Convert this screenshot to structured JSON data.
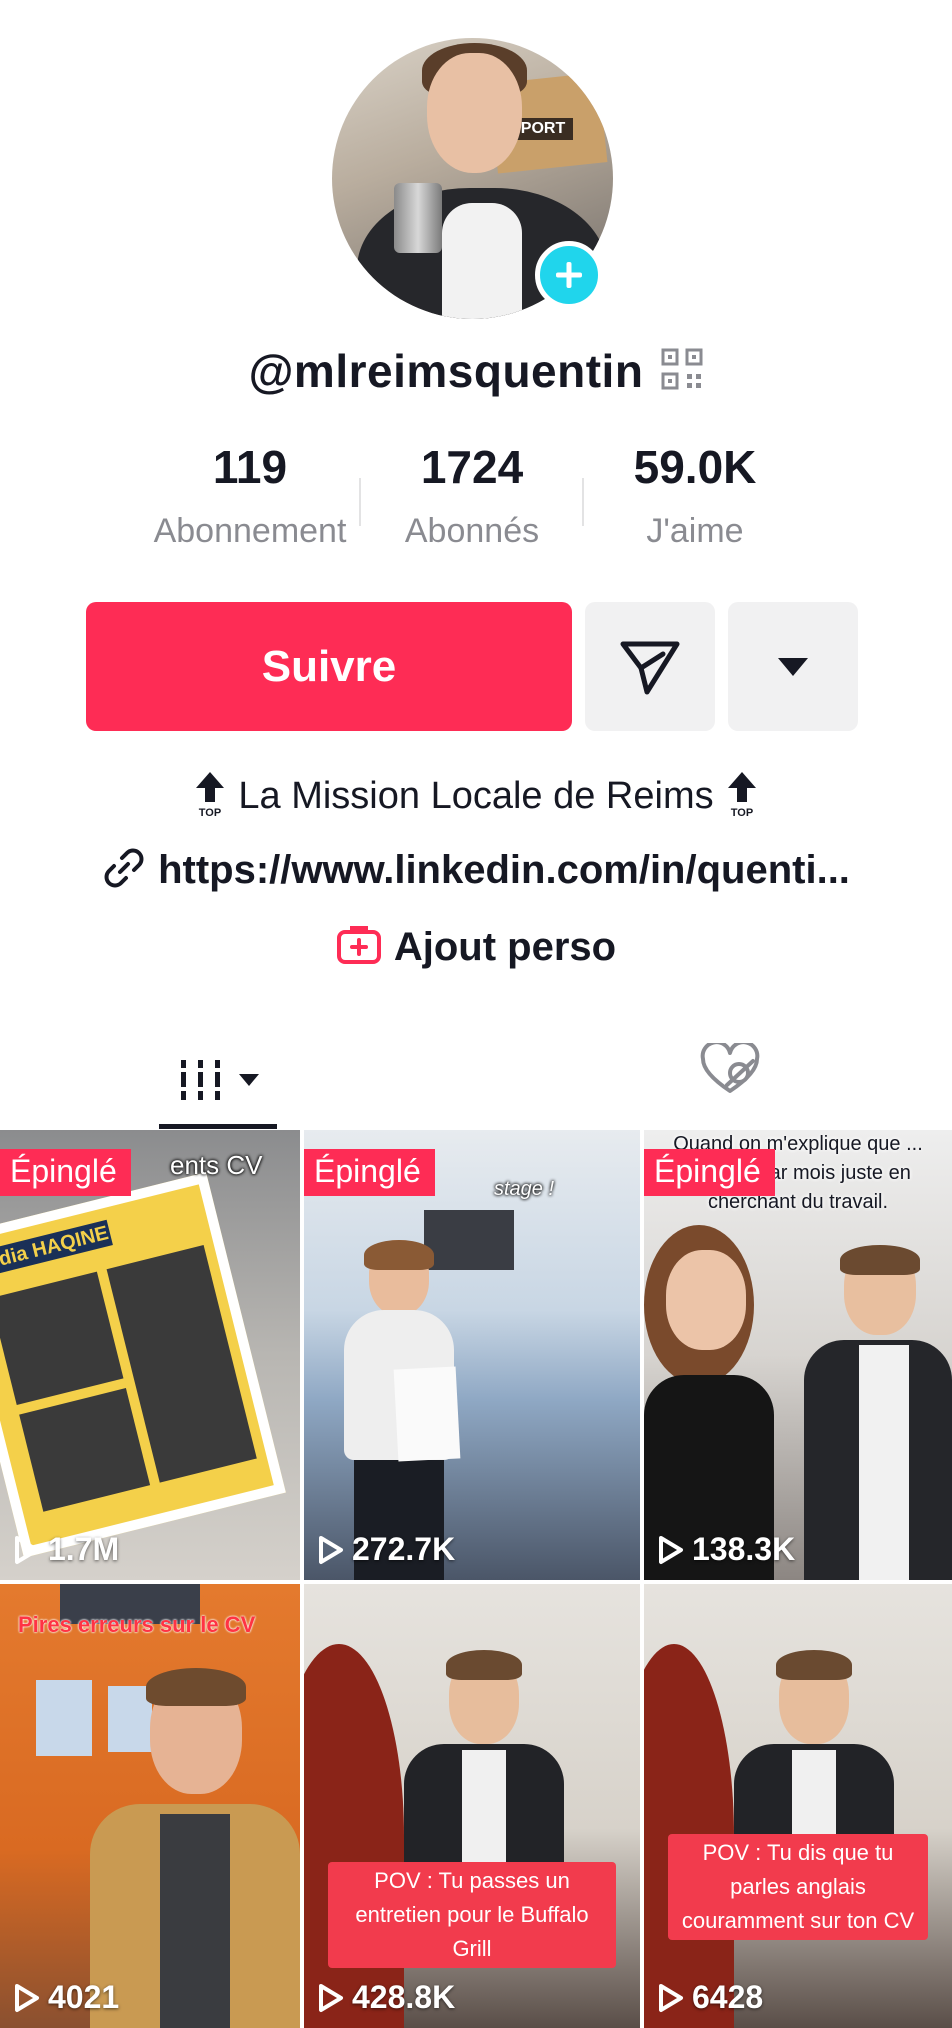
{
  "profile": {
    "username": "@mlreimsquentin",
    "avatar_add_icon": "plus-icon",
    "qr_icon": "qr-code-icon"
  },
  "stats": [
    {
      "value": "119",
      "label": "Abonnement"
    },
    {
      "value": "1724",
      "label": "Abonnés"
    },
    {
      "value": "59.0K",
      "label": "J'aime"
    }
  ],
  "actions": {
    "follow_label": "Suivre",
    "message_icon": "send-icon",
    "more_icon": "caret-down-icon"
  },
  "bio": {
    "line1": "La Mission Locale de Reims",
    "top_badge": "TOP",
    "link": "https://www.linkedin.com/in/quenti...",
    "add_perso": "Ajout perso"
  },
  "tabs": {
    "videos_icon": "grid-icon",
    "liked_icon": "hidden-heart-icon"
  },
  "colors": {
    "accent": "#fe2c55",
    "teal": "#20d5ec",
    "muted": "#8a8b91"
  },
  "videos": [
    {
      "pinned": "Épinglé",
      "views": "1.7M",
      "caption": "ents CV",
      "doc_name": "dia HAQINE"
    },
    {
      "pinned": "Épinglé",
      "views": "272.7K",
      "caption": "stage !"
    },
    {
      "pinned": "Épinglé",
      "views": "138.3K",
      "caption": "Quand on m'explique que ... er 497€ par mois juste en cherchant du travail."
    },
    {
      "pinned": "",
      "views": "4021",
      "caption": "Pires erreurs sur le CV"
    },
    {
      "pinned": "",
      "views": "428.8K",
      "caption": "POV : Tu passes un entretien pour le Buffalo Grill"
    },
    {
      "pinned": "",
      "views": "6428",
      "caption": "POV : Tu dis que tu parles anglais couramment sur ton CV"
    }
  ]
}
